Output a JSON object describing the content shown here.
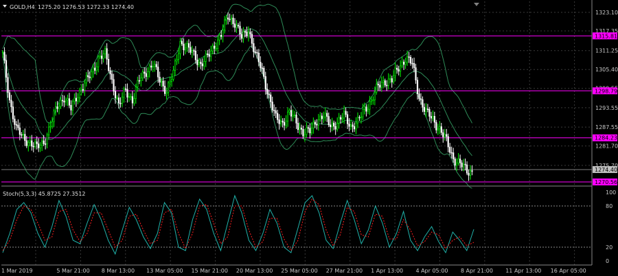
{
  "header": {
    "symbol": "GOLD,H4",
    "ohlc": "1275.20 1276.53 1272.33 1274.40"
  },
  "stoch_header": "Stoch(5,3,3) 45.8725 27.3512",
  "colors": {
    "background": "#000000",
    "bull_candle": "#00ff00",
    "bear_candle": "#ffffff",
    "bands": "#2e8b57",
    "level_line": "#ff00ff",
    "grid": "#3a3a3a",
    "stoch_main": "#20b2aa",
    "stoch_signal": "#ff2020",
    "price_tag": "#ff00ff",
    "current_tag": "#c0c0c0"
  },
  "chart_data": [
    {
      "type": "candlestick",
      "symbol": "GOLD",
      "timeframe": "H4",
      "ylim": [
        1269.5,
        1326.5
      ],
      "y_ticks": [
        "1323.10",
        "1317.35",
        "1311.25",
        "1305.40",
        "1299.55",
        "1293.55",
        "1287.55",
        "1281.70",
        "1275.70"
      ],
      "x_ticks": [
        "1 Mar 2019",
        "5 Mar 21:00",
        "8 Mar 13:00",
        "13 Mar 05:00",
        "15 Mar 21:00",
        "20 Mar 13:00",
        "25 Mar 05:00",
        "27 Mar 21:00",
        "1 Apr 13:00",
        "4 Apr 05:00",
        "8 Apr 21:00",
        "11 Apr 13:00",
        "16 Apr 05:00"
      ],
      "levels": [
        "1315.81",
        "1298.79",
        "1284.23",
        "1270.56"
      ],
      "current_price": "1274.40",
      "bollinger_bands": true,
      "close_path": [
        1310,
        1296,
        1287,
        1284,
        1283,
        1281,
        1283,
        1288,
        1294,
        1297,
        1293,
        1298,
        1301,
        1304,
        1309,
        1310,
        1302,
        1294,
        1299,
        1296,
        1302,
        1305,
        1307,
        1302,
        1299,
        1304,
        1314,
        1312,
        1310,
        1307,
        1309,
        1313,
        1316,
        1322,
        1320,
        1315,
        1318,
        1310,
        1305,
        1297,
        1290,
        1289,
        1292,
        1289,
        1286,
        1286,
        1290,
        1291,
        1288,
        1289,
        1291,
        1288,
        1289,
        1293,
        1296,
        1300,
        1302,
        1302,
        1306,
        1309,
        1307,
        1297,
        1292,
        1290,
        1287,
        1283,
        1278,
        1276,
        1274,
        1274
      ]
    },
    {
      "type": "line",
      "indicator": "Stochastic(5,3,3)",
      "ylim": [
        0,
        100
      ],
      "y_ticks": [
        "100",
        "80",
        "20",
        "0"
      ],
      "levels": [
        80,
        20
      ],
      "series": [
        {
          "values": [
            12,
            40,
            75,
            85,
            70,
            40,
            20,
            50,
            88,
            65,
            30,
            25,
            55,
            82,
            60,
            30,
            10,
            45,
            78,
            60,
            35,
            18,
            40,
            85,
            70,
            20,
            15,
            60,
            90,
            75,
            40,
            15,
            55,
            95,
            70,
            30,
            15,
            40,
            75,
            55,
            20,
            12,
            48,
            85,
            95,
            70,
            30,
            18,
            55,
            88,
            60,
            25,
            45,
            80,
            55,
            20,
            40,
            72,
            30,
            15,
            35,
            50,
            28,
            12,
            42,
            30,
            15,
            46
          ]
        },
        {
          "values": [
            15,
            30,
            60,
            80,
            75,
            55,
            30,
            35,
            72,
            75,
            45,
            28,
            40,
            70,
            70,
            45,
            20,
            30,
            65,
            68,
            45,
            25,
            30,
            70,
            75,
            40,
            18,
            40,
            80,
            82,
            55,
            25,
            35,
            80,
            80,
            45,
            20,
            28,
            62,
            62,
            32,
            15,
            30,
            72,
            90,
            82,
            45,
            22,
            38,
            78,
            72,
            38,
            35,
            68,
            65,
            32,
            32,
            60,
            45,
            22,
            28,
            42,
            38,
            18,
            30,
            35,
            22,
            27
          ]
        }
      ]
    }
  ]
}
